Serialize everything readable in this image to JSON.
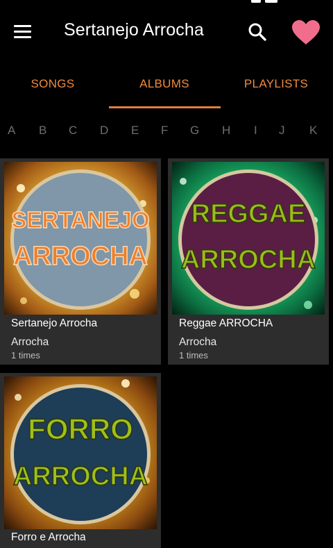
{
  "app": {
    "title": "Sertanejo Arrocha"
  },
  "icons": {
    "menu": "menu-icon",
    "search": "search-icon",
    "favorite": "heart-icon"
  },
  "tabs": [
    {
      "label": "SONGS"
    },
    {
      "label": "ALBUMS",
      "selected": true
    },
    {
      "label": "PLAYLISTS"
    }
  ],
  "alphabet": [
    "A",
    "B",
    "C",
    "D",
    "E",
    "F",
    "G",
    "H",
    "I",
    "J",
    "K"
  ],
  "albums": [
    {
      "title": "Sertanejo Arrocha",
      "artist": "Arrocha",
      "plays": "1 times",
      "art": {
        "line1": "SERTANEJO",
        "line2": "ARROCHA",
        "circle": "#7f97a8",
        "text": "#ee7f2c",
        "glow": "#f3c03c"
      }
    },
    {
      "title": "Reggae ARROCHA",
      "artist": "Arrocha",
      "plays": "1 times",
      "art": {
        "line1": "REGGAE",
        "line2": "ARROCHA",
        "circle": "#5a1e45",
        "text": "#9cbb1f",
        "glow": "#25d67a"
      }
    },
    {
      "title": "Forro e Arrocha",
      "artist": "",
      "plays": "",
      "art": {
        "line1": "FORRO",
        "line2": "ARROCHA",
        "circle": "#1e3d57",
        "text": "#9fbf1c",
        "glow": "#e3a722"
      }
    }
  ],
  "colors": {
    "accent": "#f08b3c",
    "heart": "#f06e8c",
    "card": "#2d2d2d",
    "background": "#000000"
  }
}
